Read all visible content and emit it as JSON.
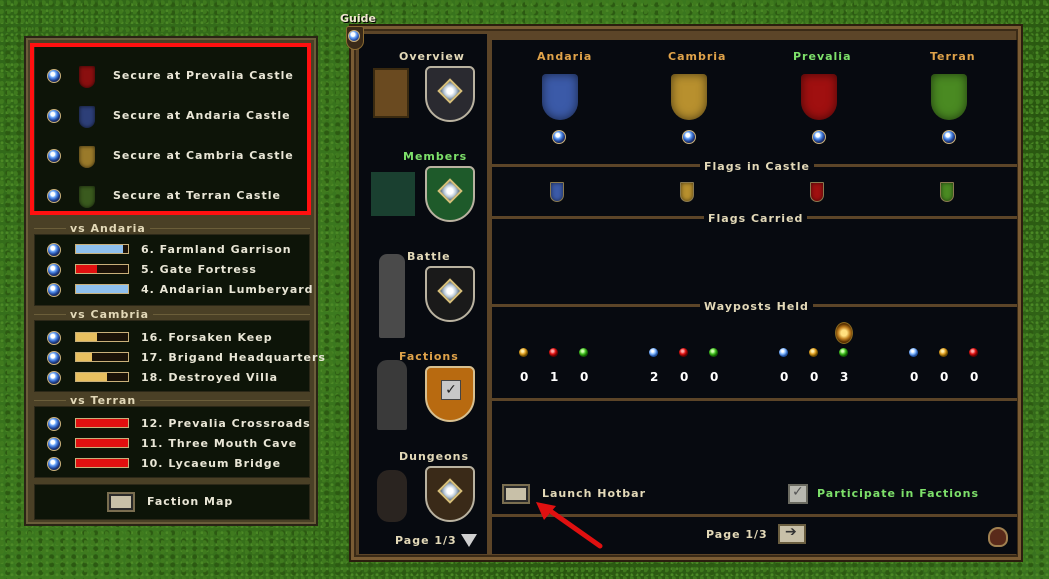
{
  "guide": {
    "label": "Guide"
  },
  "objectives": {
    "secure": [
      {
        "label": "Secure at Prevalia Castle",
        "flag_color": "#8a0f0f"
      },
      {
        "label": "Secure at Andaria Castle",
        "flag_color": "#2d3f78"
      },
      {
        "label": "Secure at Cambria Castle",
        "flag_color": "#9a7a2a"
      },
      {
        "label": "Secure at Terran Castle",
        "flag_color": "#3a5a1e"
      }
    ],
    "groups": [
      {
        "header": "vs Andaria",
        "items": [
          {
            "label": "6. Farmland Garrison",
            "bar_color": "#8fc0ee",
            "level": 0.9
          },
          {
            "label": "5. Gate Fortress",
            "bar_color": "#e01010",
            "level": 0.4
          },
          {
            "label": "4. Andarian Lumberyard",
            "bar_color": "#8fc0ee",
            "level": 1.0
          }
        ]
      },
      {
        "header": "vs Cambria",
        "items": [
          {
            "label": "16. Forsaken Keep",
            "bar_color": "#e8c060",
            "level": 0.4
          },
          {
            "label": "17. Brigand Headquarters",
            "bar_color": "#e8c060",
            "level": 0.3
          },
          {
            "label": "18. Destroyed Villa",
            "bar_color": "#e8c060",
            "level": 0.6
          }
        ]
      },
      {
        "header": "vs Terran",
        "items": [
          {
            "label": "12. Prevalia Crossroads",
            "bar_color": "#e01010",
            "level": 1.0
          },
          {
            "label": "11. Three Mouth Cave",
            "bar_color": "#e01010",
            "level": 1.0
          },
          {
            "label": "10. Lycaeum Bridge",
            "bar_color": "#e01010",
            "level": 1.0
          }
        ]
      }
    ],
    "faction_map_label": "Faction Map"
  },
  "nav": {
    "overview": "Overview",
    "members": "Members",
    "battle": "Battle",
    "factions": "Factions",
    "dungeons": "Dungeons",
    "page_label": "Page",
    "page_value": "1/3"
  },
  "factions": [
    {
      "name": "Andaria",
      "color": "#3b5aa8",
      "name_color": "#e0a34a"
    },
    {
      "name": "Cambria",
      "color": "#b8902e",
      "name_color": "#e0a34a"
    },
    {
      "name": "Prevalia",
      "color": "#a01010",
      "name_color": "#7de06a"
    },
    {
      "name": "Terran",
      "color": "#4a8a22",
      "name_color": "#e0a34a"
    }
  ],
  "sections": {
    "flags_in_castle": "Flags in Castle",
    "flags_carried": "Flags Carried",
    "wayposts_held": "Wayposts Held"
  },
  "wayposts": [
    {
      "colors": [
        "yellow",
        "red",
        "green"
      ],
      "counts": [
        "0",
        "1",
        "0"
      ]
    },
    {
      "colors": [
        "blue",
        "red",
        "green"
      ],
      "counts": [
        "2",
        "0",
        "0"
      ]
    },
    {
      "colors": [
        "blue",
        "yellow",
        "green"
      ],
      "counts": [
        "0",
        "0",
        "3"
      ]
    },
    {
      "colors": [
        "blue",
        "yellow",
        "red"
      ],
      "counts": [
        "0",
        "0",
        "0"
      ]
    }
  ],
  "footer": {
    "launch_hotbar": "Launch Hotbar",
    "participate": "Participate in Factions",
    "participate_checked": true,
    "page_label": "Page",
    "page_value": "1/3"
  },
  "colors": {
    "highlight": "#ff1010",
    "annotation_arrow": "#e01010"
  }
}
